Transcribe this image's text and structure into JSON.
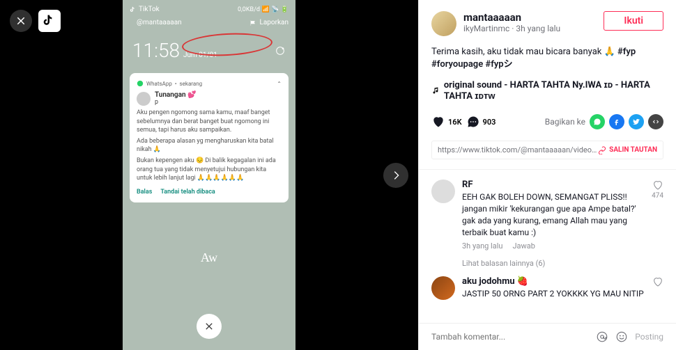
{
  "left": {
    "tiktok_label": "TikTok",
    "handle": "@mantaaaaan",
    "status_bar": "0,0KB/d",
    "laporkan": "Laporkan",
    "clock": "11:58",
    "date": "Jum 01/01",
    "whatsapp": {
      "app": "WhatsApp",
      "time": "sekarang",
      "contact": "Tunangan 💕",
      "p": "p",
      "msg1": "Aku pengen ngomong sama kamu, maaf banget sebelumnya dan berat banget buat ngomong ini semua, tapi harus aku sampaikan.",
      "msg2": "Ada beberapa alasan yg mengharuskan kita batal nikah 🙏",
      "msg3": "Bukan kepengen aku 😔 Di balik kegagalan ini ada orang tua yang tidak menyetujui hubungan kita untuk lebih lanjut lagi 🙏🙏🙏🙏🙏🙏",
      "reply": "Balas",
      "read": "Tandai telah dibaca"
    },
    "aw": "Aw"
  },
  "right": {
    "username": "mantaaaaan",
    "usermeta": "ikyMartinmc · 3h yang lalu",
    "follow": "Ikuti",
    "caption_text": "Terima kasih, aku tidak mau bicara banyak 🙏 ",
    "hashtags": "#fyp #foryoupage #fypシ",
    "music": "original sound - HARTA TAHTA Ny.IWA ɪᴅ - HARTA TAHTA ɪᴅᴛᴡ",
    "likes": "16K",
    "comments_count": "903",
    "share_label": "Bagikan ke",
    "link": "https://www.tiktok.com/@mantaaaaan/video/69126...",
    "copy": "SALIN TAUTAN",
    "comments": [
      {
        "user": "RF",
        "text": "EEH GAK BOLEH DOWN, SEMANGAT PLISS!! jangan mikir 'kekurangan gue apa Ampe batal?' gak ada yang kurang, emang Allah mau yang terbaik buat kamu :)",
        "time": "3h yang lalu",
        "reply": "Jawab",
        "likes": "474",
        "view_replies": "Lihat balasan lainnya (6)"
      },
      {
        "user": "aku jodohmu 🍓",
        "text": "JASTIP 50 ORNG PART 2 YOKKKK YG MAU NITIP",
        "time": "",
        "reply": "",
        "likes": ""
      }
    ],
    "input_placeholder": "Tambah komentar...",
    "post": "Posting"
  }
}
